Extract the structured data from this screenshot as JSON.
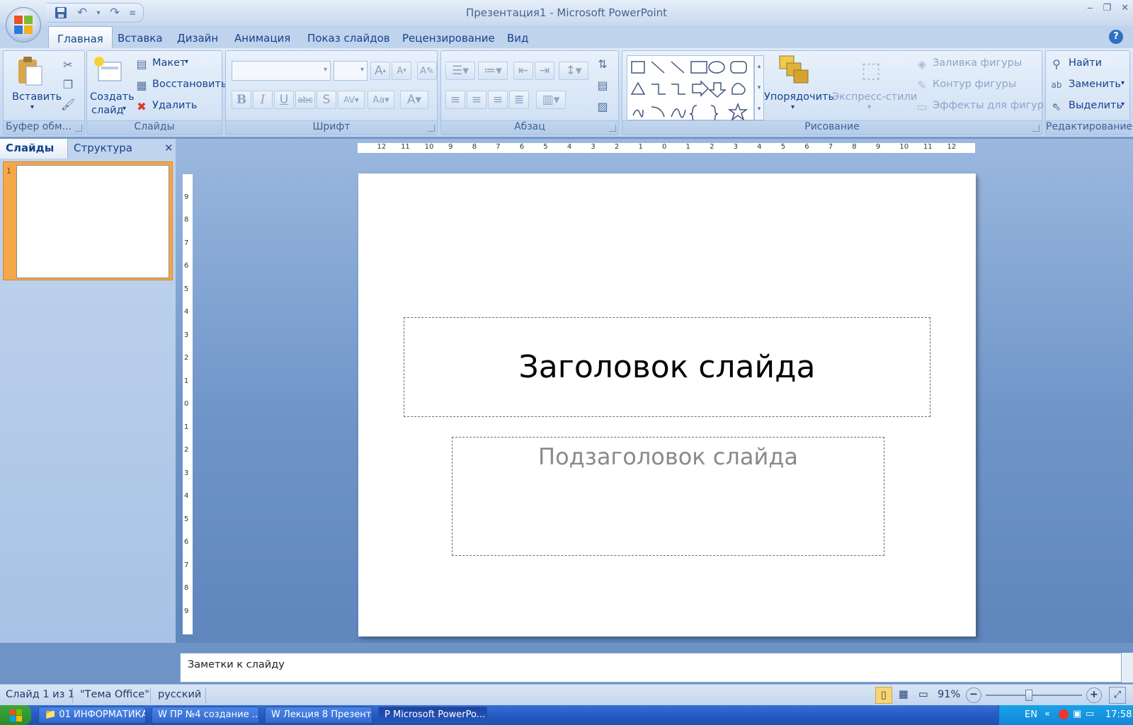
{
  "window": {
    "title": "Презентация1 - Microsoft PowerPoint"
  },
  "ribbon_tabs": [
    "Главная",
    "Вставка",
    "Дизайн",
    "Анимация",
    "Показ слайдов",
    "Рецензирование",
    "Вид"
  ],
  "groups": {
    "clipboard": {
      "label": "Буфер обм...",
      "paste": "Вставить"
    },
    "slides": {
      "label": "Слайды",
      "new_slide_1": "Создать",
      "new_slide_2": "слайд",
      "layout": "Макет",
      "reset": "Восстановить",
      "delete": "Удалить"
    },
    "font": {
      "label": "Шрифт",
      "font_name": "",
      "font_size": ""
    },
    "paragraph": {
      "label": "Абзац"
    },
    "drawing": {
      "label": "Рисование",
      "arrange": "Упорядочить",
      "quick_styles": "Экспресс-стили",
      "shape_fill": "Заливка фигуры",
      "shape_outline": "Контур фигуры",
      "shape_effects": "Эффекты для фигур"
    },
    "editing": {
      "label": "Редактирование",
      "find": "Найти",
      "replace": "Заменить",
      "select": "Выделить"
    }
  },
  "pane": {
    "tab_slides": "Слайды",
    "tab_outline": "Структура",
    "thumb_number": "1"
  },
  "ruler": {
    "h_ticks": [
      "12",
      "11",
      "10",
      "9",
      "8",
      "7",
      "6",
      "5",
      "4",
      "3",
      "2",
      "1",
      "0",
      "1",
      "2",
      "3",
      "4",
      "5",
      "6",
      "7",
      "8",
      "9",
      "10",
      "11",
      "12"
    ],
    "v_ticks": [
      "9",
      "8",
      "7",
      "6",
      "5",
      "4",
      "3",
      "2",
      "1",
      "0",
      "1",
      "2",
      "3",
      "4",
      "5",
      "6",
      "7",
      "8",
      "9"
    ]
  },
  "slide": {
    "title": "Заголовок слайда",
    "subtitle": "Подзаголовок слайда"
  },
  "notes": {
    "placeholder": "Заметки к слайду"
  },
  "status": {
    "slide_pos": "Слайд 1 из 1",
    "theme": "\"Тема Office\"",
    "language": "русский",
    "zoom": "91%",
    "zoom_percent": 91
  },
  "taskbar": {
    "items": [
      "01 ИНФОРМАТИКА",
      "ПР №4 создание ...",
      "Лекция 8 Презент...",
      "Microsoft PowerPo..."
    ],
    "lang": "EN",
    "clock": "17:58"
  },
  "colors": {
    "accent": "#15428b",
    "thumb_selected": "#f6a74a"
  }
}
